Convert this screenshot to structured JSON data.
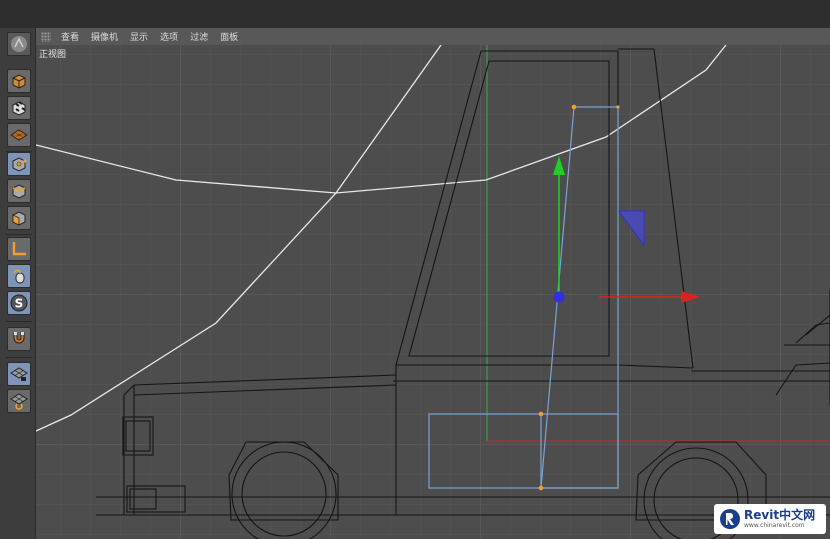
{
  "menubar": {
    "items": [
      "查看",
      "摄像机",
      "显示",
      "选项",
      "过滤",
      "面板"
    ]
  },
  "viewport": {
    "label": "正视图"
  },
  "toolbar": {
    "tools": [
      {
        "name": "logo-icon",
        "active": false
      },
      {
        "name": "model-mode-icon",
        "active": false
      },
      {
        "name": "texture-mode-icon",
        "active": false
      },
      {
        "name": "workplane-icon",
        "active": false
      },
      {
        "name": "points-mode-icon",
        "active": true
      },
      {
        "name": "edges-mode-icon",
        "active": false
      },
      {
        "name": "polygons-mode-icon",
        "active": false
      },
      {
        "name": "axis-icon",
        "active": false
      },
      {
        "name": "tweak-mode-icon",
        "active": true
      },
      {
        "name": "solo-icon",
        "active": true,
        "glyph": "S"
      },
      {
        "name": "snap-magnet-icon",
        "active": false
      },
      {
        "name": "workplane-lock-icon",
        "active": true
      },
      {
        "name": "planar-workplane-icon",
        "active": false
      }
    ]
  },
  "colors": {
    "background": "#2b2b2b",
    "toolbar": "#3d3d3d",
    "menubar": "#585858",
    "viewport": "#4d4d4d",
    "axis_x": "#e02020",
    "axis_y": "#20d020",
    "axis_z": "#3030e0",
    "selection": "#7aa3d6",
    "point": "#f0a030",
    "spline": "#e8e8e8"
  },
  "watermark": {
    "brand": "Revit",
    "brand_zh": "中文网",
    "url": "www.chinarevit.com"
  }
}
